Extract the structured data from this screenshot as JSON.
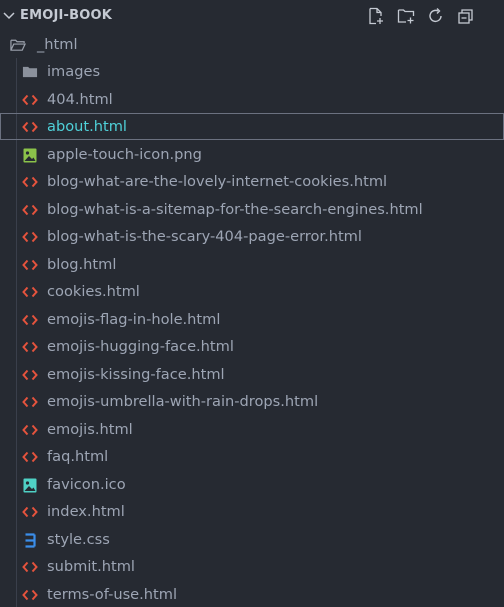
{
  "explorer": {
    "title": "EMOJI-BOOK",
    "actions": [
      {
        "name": "new-file-icon"
      },
      {
        "name": "new-folder-icon"
      },
      {
        "name": "refresh-icon"
      },
      {
        "name": "collapse-all-icon"
      }
    ],
    "root_folder": {
      "label": "_html",
      "icon": "folder-open-icon"
    },
    "items": [
      {
        "label": "images",
        "type": "folder"
      },
      {
        "label": "404.html",
        "type": "html"
      },
      {
        "label": "about.html",
        "type": "html",
        "selected": true
      },
      {
        "label": "apple-touch-icon.png",
        "type": "image"
      },
      {
        "label": "blog-what-are-the-lovely-internet-cookies.html",
        "type": "html"
      },
      {
        "label": "blog-what-is-a-sitemap-for-the-search-engines.html",
        "type": "html"
      },
      {
        "label": "blog-what-is-the-scary-404-page-error.html",
        "type": "html"
      },
      {
        "label": "blog.html",
        "type": "html"
      },
      {
        "label": "cookies.html",
        "type": "html"
      },
      {
        "label": "emojis-flag-in-hole.html",
        "type": "html"
      },
      {
        "label": "emojis-hugging-face.html",
        "type": "html"
      },
      {
        "label": "emojis-kissing-face.html",
        "type": "html"
      },
      {
        "label": "emojis-umbrella-with-rain-drops.html",
        "type": "html"
      },
      {
        "label": "emojis.html",
        "type": "html"
      },
      {
        "label": "faq.html",
        "type": "html"
      },
      {
        "label": "favicon.ico",
        "type": "ico"
      },
      {
        "label": "index.html",
        "type": "html"
      },
      {
        "label": "style.css",
        "type": "css"
      },
      {
        "label": "submit.html",
        "type": "html"
      },
      {
        "label": "terms-of-use.html",
        "type": "html"
      }
    ]
  },
  "colors": {
    "html_icon": "#e5533d",
    "css_icon": "#3b8eea",
    "image_icon": "#8bc34a",
    "ico_icon": "#4fd1c5",
    "folder_icon": "#8b919c",
    "selected_text": "#4fd1d9"
  }
}
